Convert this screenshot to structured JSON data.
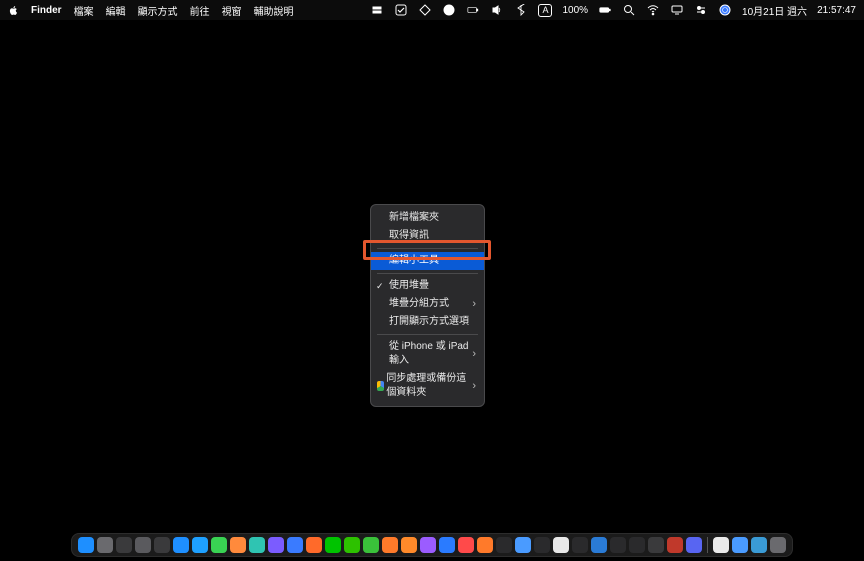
{
  "menubar": {
    "app": "Finder",
    "items": [
      "檔案",
      "編輯",
      "顯示方式",
      "前往",
      "視窗",
      "輔助說明"
    ]
  },
  "status": {
    "battery": "100%",
    "input_mode": "A",
    "date": "10月21日 週六",
    "time": "21:57:47"
  },
  "context_menu": {
    "items": [
      {
        "label": "新增檔案夾"
      },
      {
        "label": "取得資訊"
      },
      {
        "sep": true
      },
      {
        "label": "編輯小工具⋯",
        "highlight": true
      },
      {
        "sep": true
      },
      {
        "label": "使用堆疊",
        "check": true
      },
      {
        "label": "堆疊分組方式",
        "submenu": true
      },
      {
        "label": "打開顯示方式選項"
      },
      {
        "sep": true
      },
      {
        "label": "從 iPhone 或 iPad 輸入",
        "submenu": true
      },
      {
        "label": "同步處理或備份這個資料夾",
        "submenu": true,
        "icon": "drive"
      }
    ]
  },
  "dock": {
    "apps": [
      {
        "name": "finder",
        "bg": "#1e8fff"
      },
      {
        "name": "launchpad",
        "bg": "#6a6a6e"
      },
      {
        "name": "activity",
        "bg": "#3a3a3c"
      },
      {
        "name": "settings",
        "bg": "#5a5a5e"
      },
      {
        "name": "quicktime",
        "bg": "#3a3a3c"
      },
      {
        "name": "appstore",
        "bg": "#1e8fff"
      },
      {
        "name": "safari",
        "bg": "#1ea0ff"
      },
      {
        "name": "app-green",
        "bg": "#39d353"
      },
      {
        "name": "app-orange",
        "bg": "#ff8a3c"
      },
      {
        "name": "app-teal",
        "bg": "#2fc4b2"
      },
      {
        "name": "app-purple",
        "bg": "#7b5cff"
      },
      {
        "name": "app-blue2",
        "bg": "#3a7bff"
      },
      {
        "name": "app-orange2",
        "bg": "#ff6a2a"
      },
      {
        "name": "line",
        "bg": "#00c300"
      },
      {
        "name": "wechat",
        "bg": "#2dc100"
      },
      {
        "name": "app-green3",
        "bg": "#3ac13a"
      },
      {
        "name": "app-orange3",
        "bg": "#ff7a2a"
      },
      {
        "name": "app-orange4",
        "bg": "#ff8a2a"
      },
      {
        "name": "podcast",
        "bg": "#9b5cff"
      },
      {
        "name": "app-blue3",
        "bg": "#2a7bff"
      },
      {
        "name": "app-red",
        "bg": "#ff4a4a"
      },
      {
        "name": "app-orange5",
        "bg": "#ff7a2a"
      },
      {
        "name": "app-dark",
        "bg": "#2a2a2c"
      },
      {
        "name": "app-blue4",
        "bg": "#4a9bff"
      },
      {
        "name": "app-dark2",
        "bg": "#2a2a2c"
      },
      {
        "name": "app-white",
        "bg": "#e8e8e8"
      },
      {
        "name": "app-dark3",
        "bg": "#2a2a2c"
      },
      {
        "name": "vscode",
        "bg": "#2a7bd6"
      },
      {
        "name": "terminal",
        "bg": "#2a2a2c"
      },
      {
        "name": "app-dark4",
        "bg": "#2a2a2c"
      },
      {
        "name": "app-dark5",
        "bg": "#3a3a3c"
      },
      {
        "name": "filezilla",
        "bg": "#c0392b"
      },
      {
        "name": "discord",
        "bg": "#5865f2"
      }
    ],
    "right": [
      {
        "name": "notes",
        "bg": "#eaeaea"
      },
      {
        "name": "app-misc",
        "bg": "#4a9bff"
      },
      {
        "name": "folder",
        "bg": "#3a9bd6"
      },
      {
        "name": "trash",
        "bg": "#6a6a6e"
      }
    ]
  }
}
